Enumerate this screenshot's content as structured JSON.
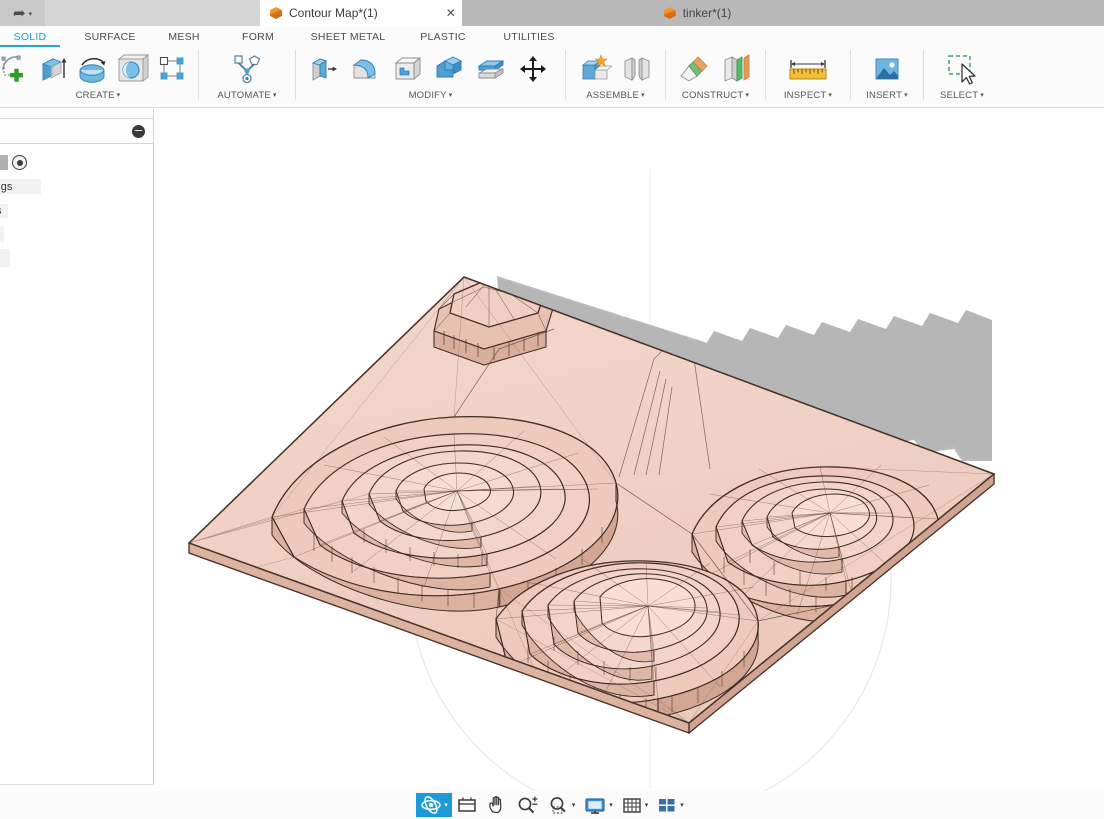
{
  "window": {
    "redo_button": {
      "icon": "redo-arrow-icon",
      "caret": "▾"
    },
    "tabs": [
      {
        "label": "Contour Map*(1)",
        "icon": "fusion-cube-icon",
        "active": true,
        "closable": true
      },
      {
        "label": "tinker*(1)",
        "icon": "fusion-cube-icon",
        "active": false,
        "closable": false
      }
    ],
    "close_glyph": "✕"
  },
  "ribbon": {
    "tabs": [
      {
        "label": "SOLID",
        "active": true
      },
      {
        "label": "SURFACE",
        "active": false
      },
      {
        "label": "MESH",
        "active": false
      },
      {
        "label": "FORM",
        "active": false
      },
      {
        "label": "SHEET METAL",
        "active": false
      },
      {
        "label": "PLASTIC",
        "active": false
      },
      {
        "label": "UTILITIES",
        "active": false
      }
    ],
    "active_color": "#24a5db",
    "groups": [
      {
        "label": "CREATE",
        "caret": "▾",
        "tools": [
          "new-sketch-icon",
          "extrude-icon",
          "revolve-icon",
          "sphere-icon",
          "pattern-icon"
        ]
      },
      {
        "label": "AUTOMATE",
        "caret": "▾",
        "tools": [
          "automated-modeling-icon"
        ]
      },
      {
        "label": "MODIFY",
        "caret": "▾",
        "tools": [
          "press-pull-icon",
          "fillet-icon",
          "shell-icon",
          "combine-icon",
          "split-body-icon",
          "move-copy-icon"
        ]
      },
      {
        "label": "ASSEMBLE",
        "caret": "▾",
        "tools": [
          "new-component-icon",
          "joint-icon"
        ]
      },
      {
        "label": "CONSTRUCT",
        "caret": "▾",
        "tools": [
          "offset-plane-icon",
          "plane-along-path-icon"
        ]
      },
      {
        "label": "INSPECT",
        "caret": "▾",
        "tools": [
          "measure-icon"
        ]
      },
      {
        "label": "INSERT",
        "caret": "▾",
        "tools": [
          "insert-canvas-icon"
        ]
      },
      {
        "label": "SELECT",
        "caret": "▾",
        "tools": [
          "select-window-icon"
        ]
      }
    ]
  },
  "left_panel": {
    "collapse_button_glyph": "–",
    "add_button_glyph": "+",
    "clipped_items": [
      {
        "text": "ettings"
      },
      {
        "text": "ws"
      },
      {
        "text": ""
      },
      {
        "text": ""
      }
    ]
  },
  "viewport": {
    "model_name": "Contour Map",
    "model_fill": "#f0cfc2",
    "model_edge": "#5d4038",
    "shadow_color": "#b4b4b4",
    "background": "#ffffff",
    "orbit_ring_color": "#e4e4e4"
  },
  "navbar": {
    "buttons": [
      {
        "name": "orbit-icon",
        "selected": true,
        "caret": "▾"
      },
      {
        "name": "pan-to-fit-icon",
        "selected": false,
        "caret": ""
      },
      {
        "name": "pan-hand-icon",
        "selected": false,
        "caret": ""
      },
      {
        "name": "zoom-icon",
        "selected": false,
        "caret": ""
      },
      {
        "name": "zoom-window-icon",
        "selected": false,
        "caret": "▾"
      },
      {
        "name": "display-settings-icon",
        "selected": false,
        "caret": "▾"
      },
      {
        "name": "grid-snap-icon",
        "selected": false,
        "caret": "▾"
      },
      {
        "name": "viewports-icon",
        "selected": false,
        "caret": "▾"
      }
    ]
  }
}
